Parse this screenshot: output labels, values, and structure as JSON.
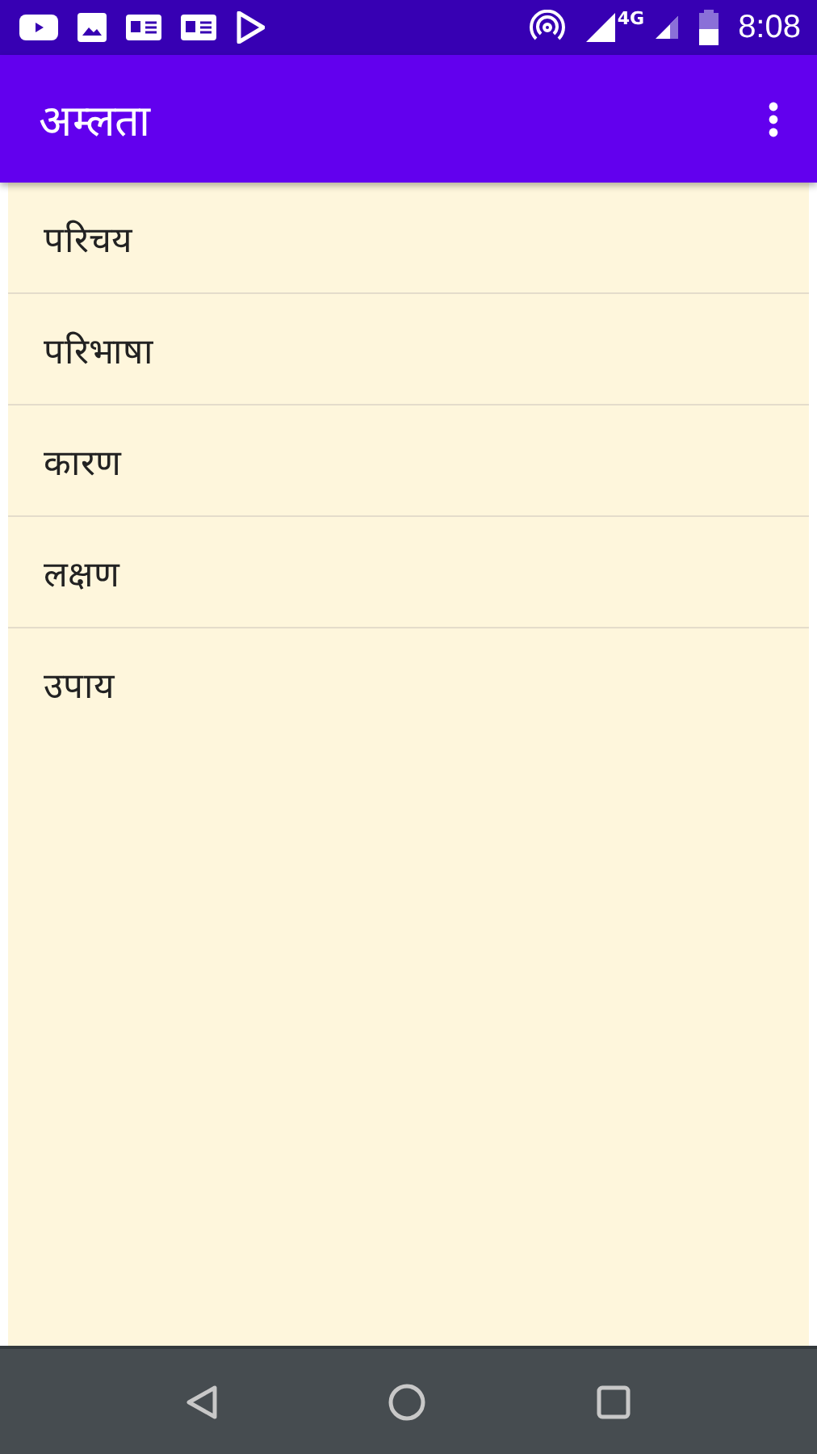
{
  "status_bar": {
    "network": "4G",
    "time": "8:08"
  },
  "app_bar": {
    "title": "अम्लता"
  },
  "topics": [
    {
      "label": "परिचय"
    },
    {
      "label": "परिभाषा"
    },
    {
      "label": "कारण"
    },
    {
      "label": "लक्षण"
    },
    {
      "label": "उपाय"
    }
  ]
}
